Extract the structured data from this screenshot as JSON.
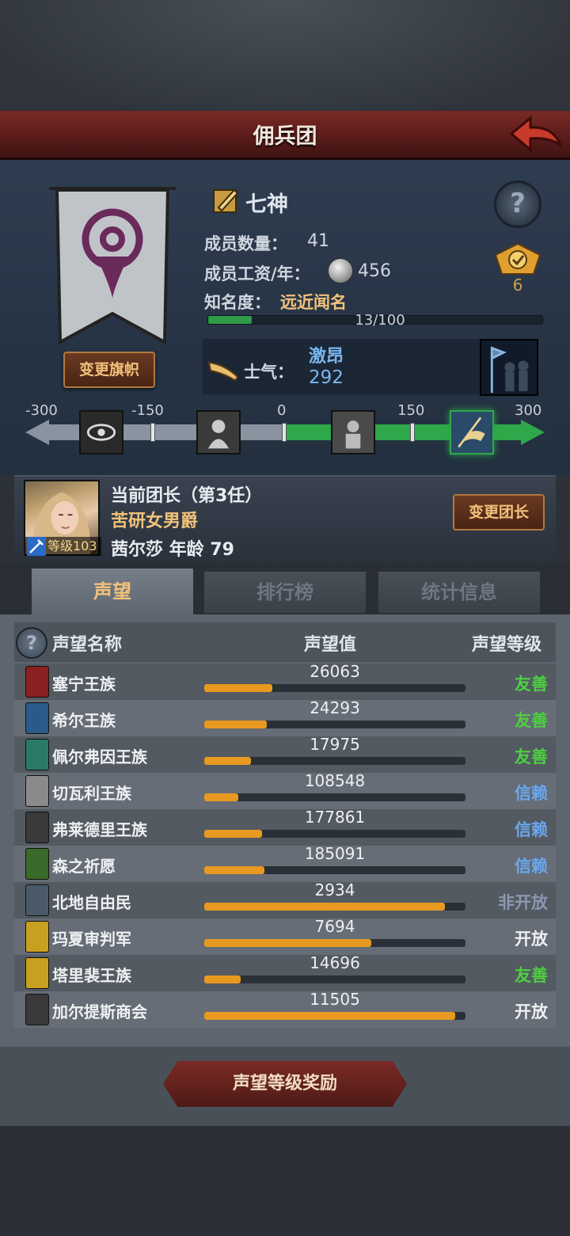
{
  "header": {
    "title": "佣兵团"
  },
  "guild": {
    "name": "七神",
    "members_label": "成员数量：",
    "members": "41",
    "salary_label": "成员工资/年：",
    "salary": "456",
    "fame_label": "知名度：",
    "fame_value": "远近闻名",
    "fame_progress": "13/100",
    "fame_fraction": 0.13,
    "rank": "6",
    "change_flag": "变更旗帜"
  },
  "morale": {
    "label": "士气：",
    "state": "激昂",
    "value": "292",
    "scale_labels": [
      "-300",
      "-150",
      "0",
      "150",
      "300"
    ]
  },
  "leader": {
    "title": "当前团长（第3任）",
    "rank": "苦研女男爵",
    "level": "等级103",
    "name_age": "茜尔莎  年龄 79",
    "change_button": "变更团长"
  },
  "tabs": [
    "声望",
    "排行榜",
    "统计信息"
  ],
  "list_header": {
    "name": "声望名称",
    "value": "声望值",
    "level": "声望等级"
  },
  "colors": {
    "friendly": "#4cd040",
    "trust": "#6aa8f0",
    "closed": "#8a98b0",
    "open": "#eef0f2"
  },
  "reputation": [
    {
      "name": "塞宁王族",
      "value": "26063",
      "fill": 0.26,
      "level": "友善",
      "color": "#4cd040",
      "icon_color": "#8a2020"
    },
    {
      "name": "希尔王族",
      "value": "24293",
      "fill": 0.24,
      "level": "友善",
      "color": "#4cd040",
      "icon_color": "#2a5a8a"
    },
    {
      "name": "佩尔弗因王族",
      "value": "17975",
      "fill": 0.18,
      "level": "友善",
      "color": "#4cd040",
      "icon_color": "#2a7a6a"
    },
    {
      "name": "切瓦利王族",
      "value": "108548",
      "fill": 0.13,
      "level": "信赖",
      "color": "#6aa8f0",
      "icon_color": "#8a8a8a"
    },
    {
      "name": "弗莱德里王族",
      "value": "177861",
      "fill": 0.22,
      "level": "信赖",
      "color": "#6aa8f0",
      "icon_color": "#3a3a3a"
    },
    {
      "name": "森之祈愿",
      "value": "185091",
      "fill": 0.23,
      "level": "信赖",
      "color": "#6aa8f0",
      "icon_color": "#3a6a2a"
    },
    {
      "name": "北地自由民",
      "value": "2934",
      "fill": 0.92,
      "level": "非开放",
      "color": "#8a98b0",
      "icon_color": "#4a5a6a"
    },
    {
      "name": "玛夏审判军",
      "value": "7694",
      "fill": 0.64,
      "level": "开放",
      "color": "#eef0f2",
      "icon_color": "#c8a020"
    },
    {
      "name": "塔里裴王族",
      "value": "14696",
      "fill": 0.14,
      "level": "友善",
      "color": "#4cd040",
      "icon_color": "#c8a020"
    },
    {
      "name": "加尔提斯商会",
      "value": "11505",
      "fill": 0.96,
      "level": "开放",
      "color": "#eef0f2",
      "icon_color": "#3a3a3a"
    }
  ],
  "reward_button": "声望等级奖励"
}
